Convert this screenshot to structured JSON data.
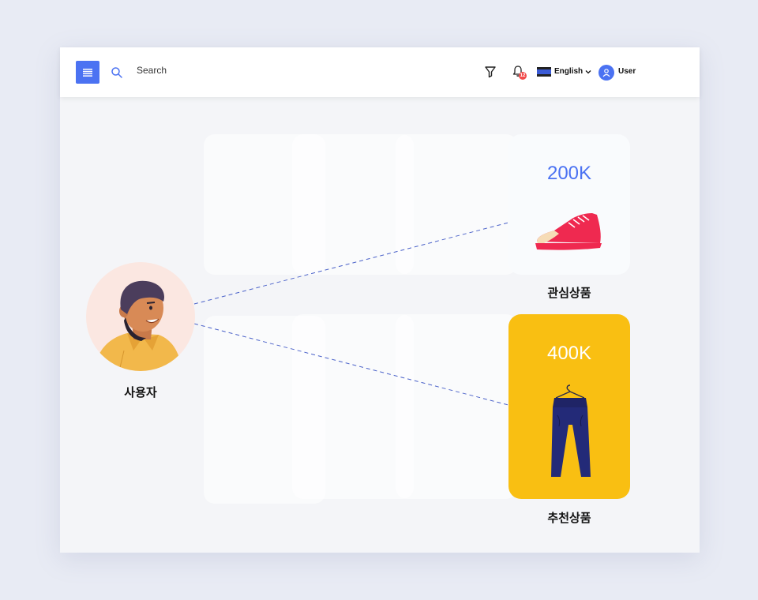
{
  "header": {
    "search_label": "Search",
    "language_label": "English",
    "user_label": "User",
    "notification_count": "12"
  },
  "user_node": {
    "caption": "사용자"
  },
  "cards": [
    {
      "value": "200K",
      "caption": "관심상품",
      "product": "sneaker",
      "bg_color": "#f9fbfd",
      "value_color": "#4b72f2"
    },
    {
      "value": "400K",
      "caption": "추천상품",
      "product": "pants",
      "bg_color": "#f9bf12",
      "value_color": "#ffffff"
    }
  ],
  "colors": {
    "accent": "#4b72f2",
    "highlight": "#f9bf12",
    "connector": "#4b62c9"
  },
  "icons": [
    "menu-icon",
    "search-icon",
    "filter-icon",
    "bell-icon",
    "chevron-down-icon",
    "user-icon",
    "sneaker-icon",
    "pants-icon"
  ]
}
